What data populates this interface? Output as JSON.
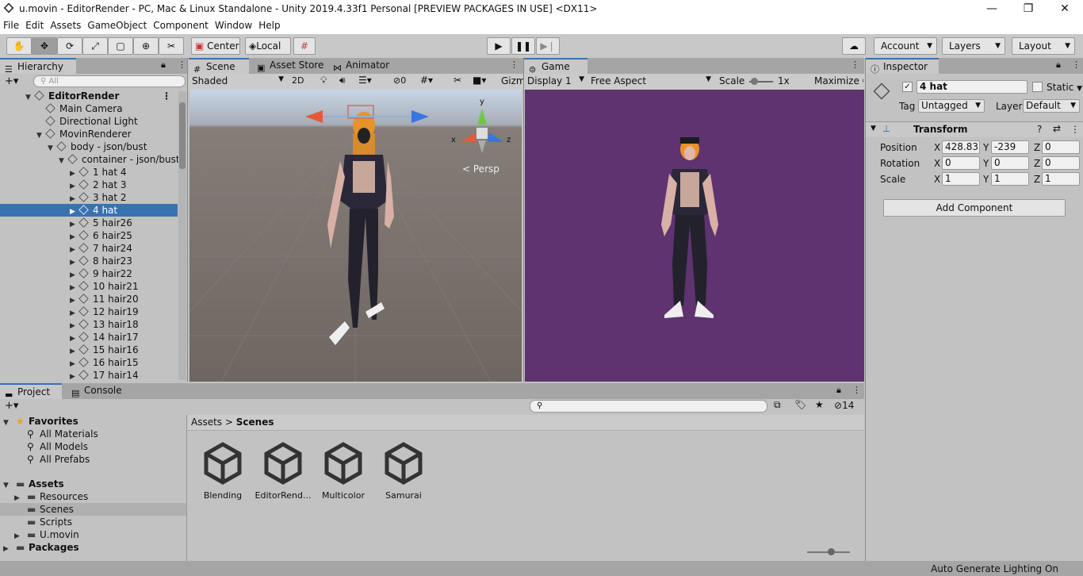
{
  "window": {
    "title": "u.movin - EditorRender - PC, Mac & Linux Standalone - Unity 2019.4.33f1 Personal [PREVIEW PACKAGES IN USE] <DX11>",
    "minimize": "—",
    "maximize": "❐",
    "close": "✕"
  },
  "menu": [
    "File",
    "Edit",
    "Assets",
    "GameObject",
    "Component",
    "Window",
    "Help"
  ],
  "toolbar": {
    "center_label": "Center",
    "local_label": "Local",
    "account_label": "Account",
    "layers_label": "Layers",
    "layout_label": "Layout"
  },
  "hierarchy": {
    "tab_label": "Hierarchy",
    "search_placeholder": "All",
    "rows": [
      {
        "label": "EditorRender",
        "level": 0,
        "arrow": "▼",
        "bold": true
      },
      {
        "label": "Main Camera",
        "level": 1,
        "arrow": ""
      },
      {
        "label": "Directional Light",
        "level": 1,
        "arrow": ""
      },
      {
        "label": "MovinRenderer",
        "level": 1,
        "arrow": "▼"
      },
      {
        "label": "body - json/bust",
        "level": 2,
        "arrow": "▼"
      },
      {
        "label": "container - json/bust",
        "level": 3,
        "arrow": "▼"
      },
      {
        "label": "1  hat 4",
        "level": 4,
        "arrow": "▶"
      },
      {
        "label": "2  hat 3",
        "level": 4,
        "arrow": "▶"
      },
      {
        "label": "3  hat 2",
        "level": 4,
        "arrow": "▶"
      },
      {
        "label": "4  hat",
        "level": 4,
        "arrow": "▶",
        "selected": true
      },
      {
        "label": "5  hair26",
        "level": 4,
        "arrow": "▶"
      },
      {
        "label": "6  hair25",
        "level": 4,
        "arrow": "▶"
      },
      {
        "label": "7  hair24",
        "level": 4,
        "arrow": "▶"
      },
      {
        "label": "8  hair23",
        "level": 4,
        "arrow": "▶"
      },
      {
        "label": "9  hair22",
        "level": 4,
        "arrow": "▶"
      },
      {
        "label": "10  hair21",
        "level": 4,
        "arrow": "▶"
      },
      {
        "label": "11  hair20",
        "level": 4,
        "arrow": "▶"
      },
      {
        "label": "12  hair19",
        "level": 4,
        "arrow": "▶"
      },
      {
        "label": "13  hair18",
        "level": 4,
        "arrow": "▶"
      },
      {
        "label": "14  hair17",
        "level": 4,
        "arrow": "▶"
      },
      {
        "label": "15  hair16",
        "level": 4,
        "arrow": "▶"
      },
      {
        "label": "16  hair15",
        "level": 4,
        "arrow": "▶"
      },
      {
        "label": "17  hair14",
        "level": 4,
        "arrow": "▶"
      }
    ]
  },
  "scene": {
    "tabs": [
      "Scene",
      "Asset Store",
      "Animator"
    ],
    "shading": "Shaded",
    "mode_2d": "2D",
    "hidden_count": "0",
    "gizmos": "Gizm",
    "persp_label": "Persp",
    "axis_x": "x",
    "axis_y": "y",
    "axis_z": "z"
  },
  "game": {
    "tab_label": "Game",
    "display": "Display 1",
    "aspect": "Free Aspect",
    "scale_label": "Scale",
    "scale_value": "1x",
    "maximize": "Maximize O",
    "bg_color": "#5e3370"
  },
  "inspector": {
    "tab_label": "Inspector",
    "object_name": "4  hat",
    "static_label": "Static",
    "tag_label": "Tag",
    "tag_value": "Untagged",
    "layer_label": "Layer",
    "layer_value": "Default",
    "component_title": "Transform",
    "rows": [
      {
        "label": "Position",
        "x": "428.837",
        "y": "-239",
        "z": "0"
      },
      {
        "label": "Rotation",
        "x": "0",
        "y": "0",
        "z": "0"
      },
      {
        "label": "Scale",
        "x": "1",
        "y": "1",
        "z": "1"
      }
    ],
    "add_component": "Add Component"
  },
  "project": {
    "tabs": [
      "Project",
      "Console"
    ],
    "hidden_count": "14",
    "tree": [
      {
        "label": "Favorites",
        "level": 0,
        "arrow": "▼",
        "bold": true,
        "icon": "star"
      },
      {
        "label": "All Materials",
        "level": 1,
        "icon": "search"
      },
      {
        "label": "All Models",
        "level": 1,
        "icon": "search"
      },
      {
        "label": "All Prefabs",
        "level": 1,
        "icon": "search"
      },
      {
        "label": "Assets",
        "level": 0,
        "arrow": "▼",
        "bold": true,
        "icon": "folder"
      },
      {
        "label": "Resources",
        "level": 1,
        "arrow": "▶",
        "icon": "folder"
      },
      {
        "label": "Scenes",
        "level": 1,
        "icon": "folder",
        "selected": true
      },
      {
        "label": "Scripts",
        "level": 1,
        "icon": "folder"
      },
      {
        "label": "U.movin",
        "level": 1,
        "arrow": "▶",
        "icon": "folder"
      },
      {
        "label": "Packages",
        "level": 0,
        "arrow": "▶",
        "bold": true,
        "icon": "folder"
      }
    ],
    "breadcrumb": [
      "Assets",
      "Scenes"
    ],
    "files": [
      "Blending",
      "EditorRend...",
      "Multicolor",
      "Samurai"
    ]
  },
  "status": {
    "text": "Auto Generate Lighting On"
  }
}
